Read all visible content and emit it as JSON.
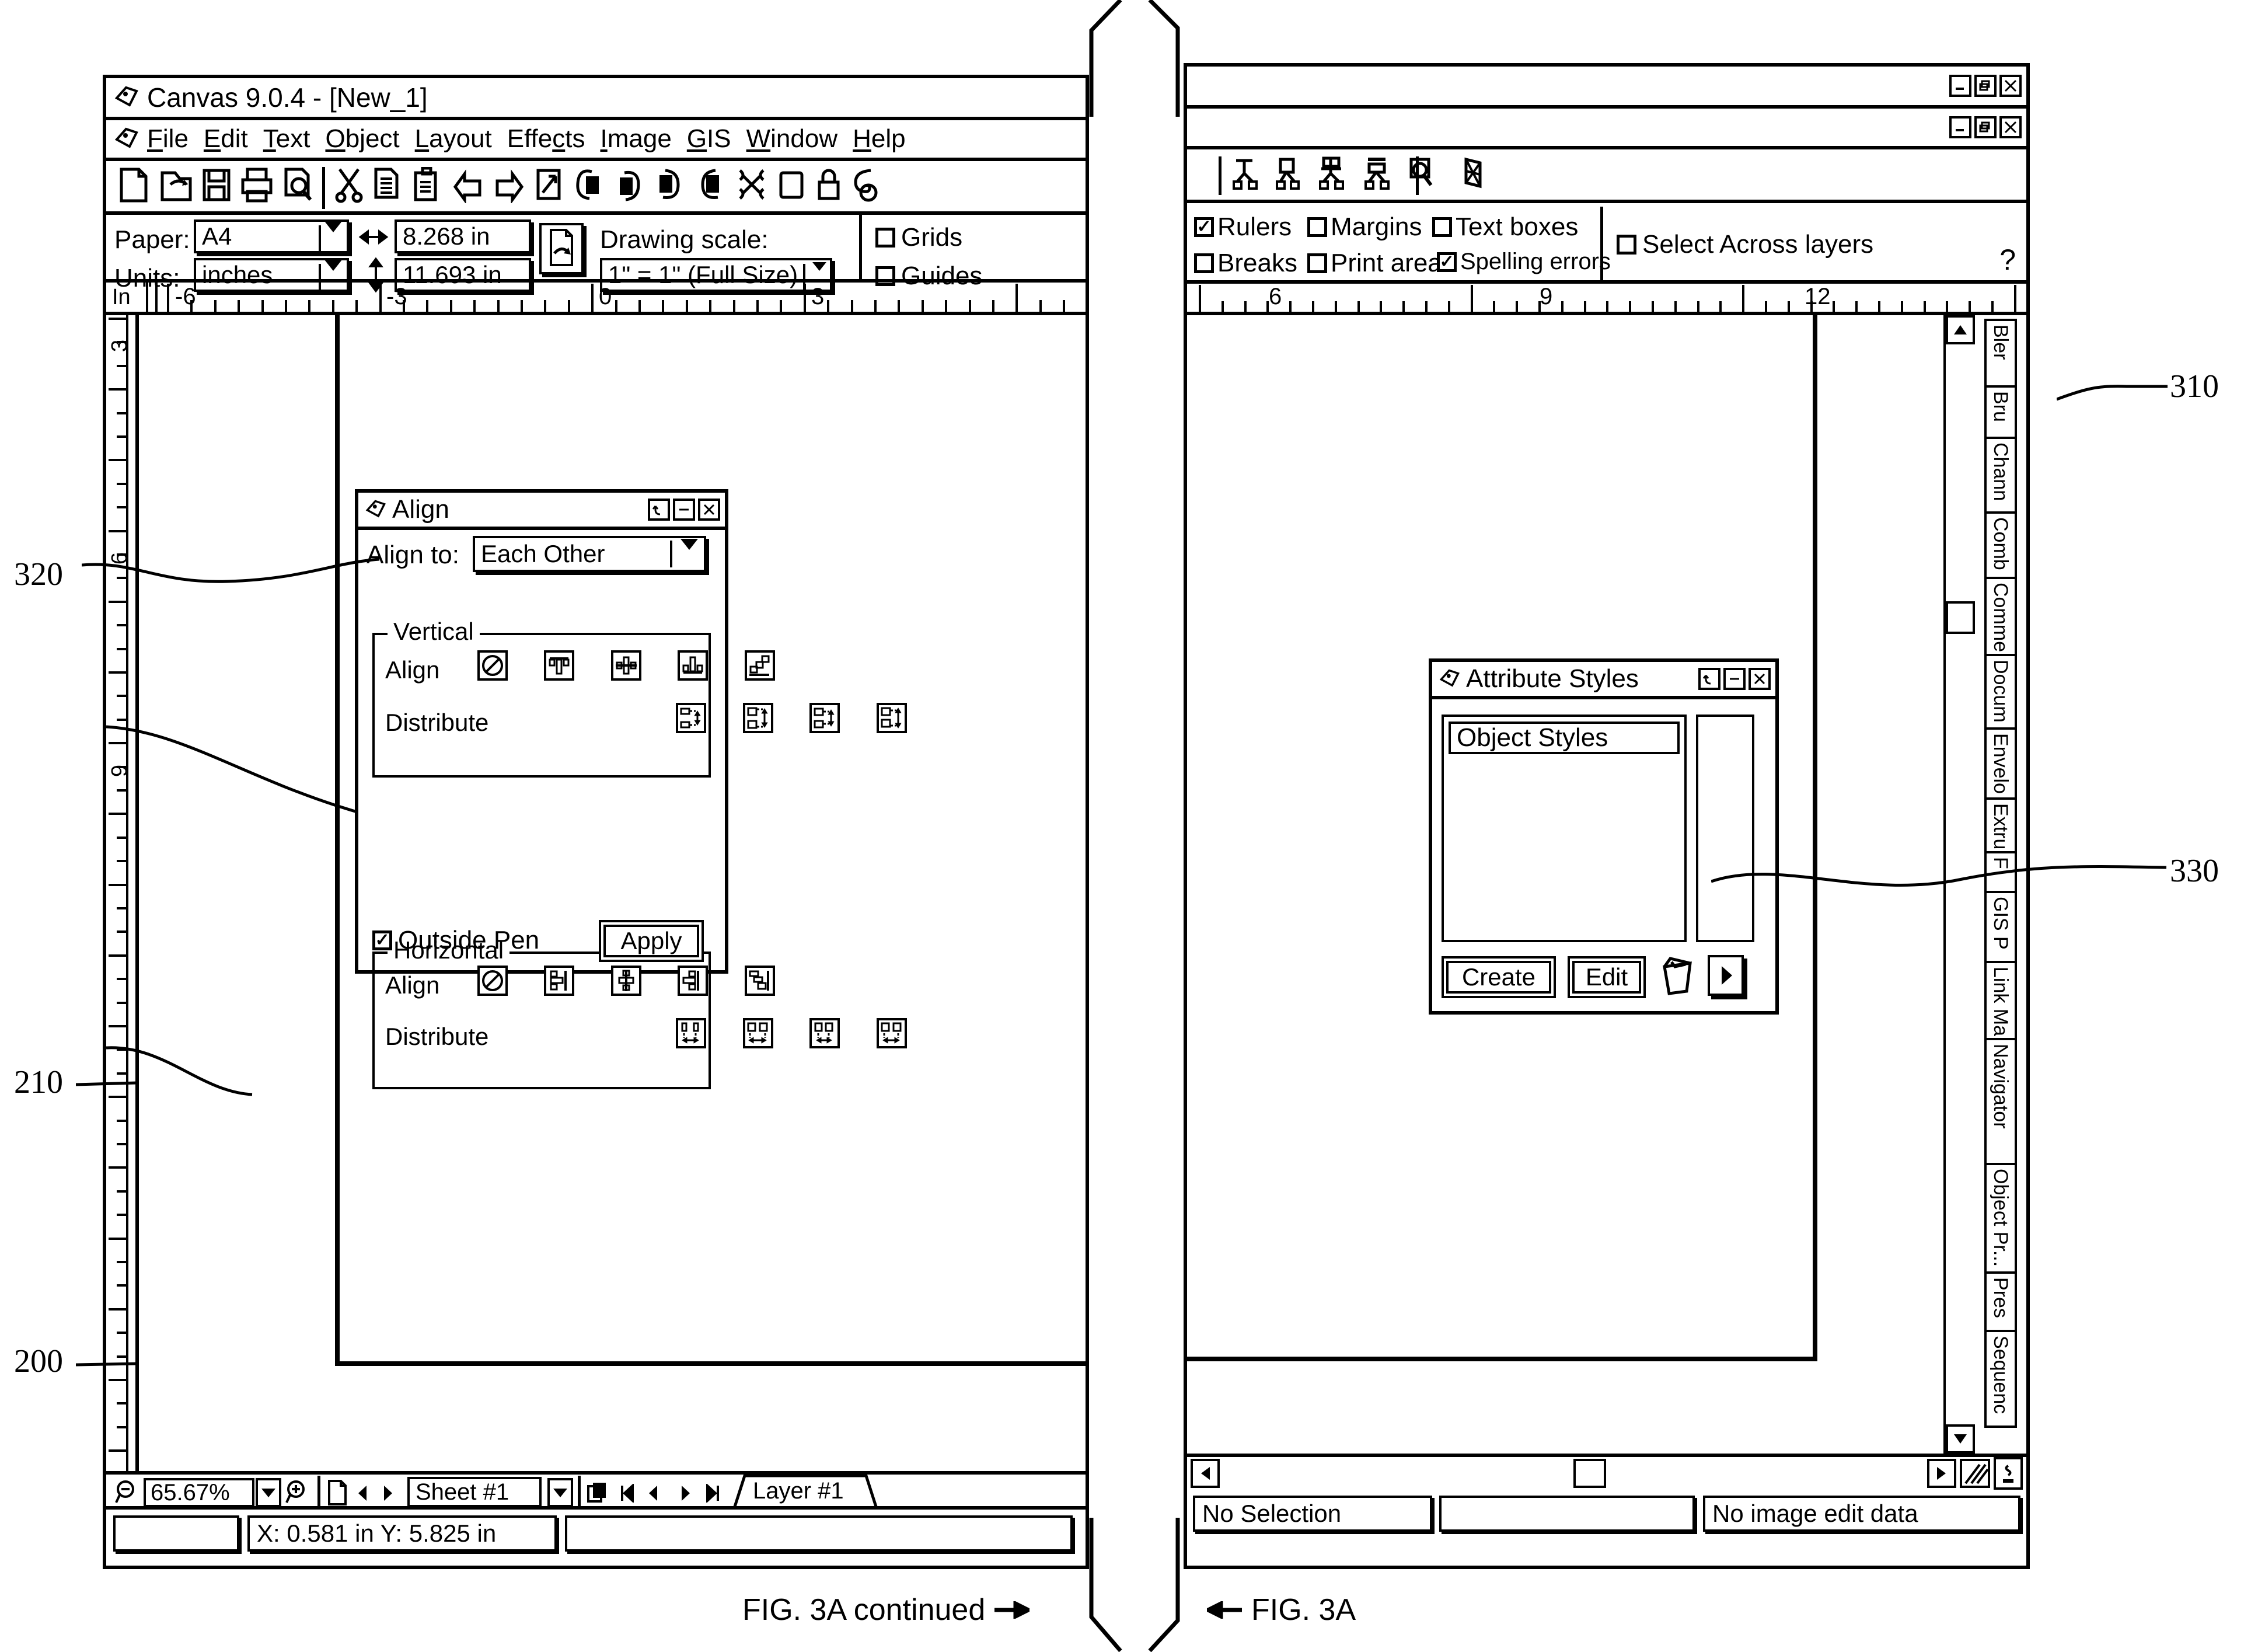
{
  "figure": {
    "left_caption": "FIG. 3A continued",
    "right_caption": "FIG. 3A",
    "ref_320": "320",
    "ref_210": "210",
    "ref_200": "200",
    "ref_310": "310",
    "ref_330": "330"
  },
  "left_window": {
    "title": "Canvas 9.0.4 - [New_1]",
    "menu": [
      {
        "pre": "",
        "u": "F",
        "post": "ile"
      },
      {
        "pre": "",
        "u": "E",
        "post": "dit"
      },
      {
        "pre": "",
        "u": "T",
        "post": "ext"
      },
      {
        "pre": "",
        "u": "O",
        "post": "bject"
      },
      {
        "pre": "",
        "u": "L",
        "post": "ayout"
      },
      {
        "pre": "Effe",
        "u": "c",
        "post": "ts"
      },
      {
        "pre": "",
        "u": "I",
        "post": "mage"
      },
      {
        "pre": "",
        "u": "G",
        "post": "IS"
      },
      {
        "pre": "",
        "u": "W",
        "post": "indow"
      },
      {
        "pre": "",
        "u": "H",
        "post": "elp"
      }
    ],
    "toolbar_icons": [
      "new-document-icon",
      "open-folder-icon",
      "save-disk-icon",
      "print-icon",
      "print-preview-icon",
      "cut-scissors-icon",
      "copy-icon",
      "paste-icon",
      "undo-icon",
      "redo-icon",
      "link-icon",
      "group-icon",
      "ungroup-icon",
      "lock-object-icon",
      "unlock-object-icon",
      "transform-icon",
      "rectangle-icon",
      "lock-icon",
      "lasso-icon"
    ],
    "paper": {
      "paper_label": "Paper:",
      "paper_value": "A4",
      "units_label": "Units:",
      "units_value": "inches",
      "width_value": "8.268 in",
      "height_value": "11.693 in",
      "orientation_icon": "page-orientation-icon",
      "scale_label": "Drawing scale:",
      "scale_value": "1\" = 1\" (Full Size)",
      "grids_label": "Grids",
      "grids_checked": false,
      "guides_label": "Guides",
      "guides_checked": false
    },
    "ruler": {
      "unit_label": "In",
      "ticks": [
        "-6",
        "-3",
        "0",
        "3"
      ],
      "v_ticks": [
        "3",
        "6",
        "9"
      ]
    },
    "zoombar": {
      "zoom_out_icon": "zoom-out-icon",
      "zoom_value": "65.67%",
      "zoom_in_icon": "zoom-in-icon",
      "sheet_icon": "sheet-icon",
      "sheet_value": "Sheet #1",
      "layer_icon": "layers-icon",
      "layer_value": "Layer #1"
    },
    "statusbar": {
      "left_value": "",
      "coords_value": "X: 0.581 in  Y: 5.825 in",
      "right_value": ""
    }
  },
  "align_dialog": {
    "title": "Align",
    "align_to_label": "Align to:",
    "align_to_value": "Each Other",
    "vertical_label": "Vertical",
    "horizontal_label": "Horizontal",
    "align_label": "Align",
    "distribute_label": "Distribute",
    "vertical_align_icons": [
      "align-none-icon",
      "align-top-icon",
      "align-vcenter-icon",
      "align-bottom-icon",
      "align-stagger-v-icon"
    ],
    "vertical_distribute_icons": [
      "distribute-v-1-icon",
      "distribute-v-2-icon",
      "distribute-v-3-icon",
      "distribute-v-4-icon"
    ],
    "horizontal_align_icons": [
      "align-none-icon",
      "align-left-icon",
      "align-hcenter-icon",
      "align-right-icon",
      "align-stagger-h-icon"
    ],
    "horizontal_distribute_icons": [
      "distribute-h-1-icon",
      "distribute-h-2-icon",
      "distribute-h-3-icon",
      "distribute-h-4-icon"
    ],
    "outside_pen_label": "Outside Pen",
    "outside_pen_checked": true,
    "apply_label": "Apply"
  },
  "right_window": {
    "toolbar_icons": [
      "gis-tool-1-icon",
      "gis-tool-2-icon",
      "gis-tool-3-icon",
      "gis-tool-4-icon",
      "gis-tool-5-icon",
      "cube-icon"
    ],
    "options": {
      "rulers_label": "Rulers",
      "rulers_checked": true,
      "margins_label": "Margins",
      "margins_checked": false,
      "textboxes_label": "Text boxes",
      "textboxes_checked": false,
      "breaks_label": "Breaks",
      "breaks_checked": false,
      "printarea_label": "Print area",
      "printarea_checked": false,
      "spelling_label": "Spelling errors",
      "spelling_checked": true,
      "select_across_label": "Select Across layers",
      "select_across_checked": false,
      "help_label": "?"
    },
    "ruler": {
      "ticks": [
        "6",
        "9",
        "12"
      ]
    },
    "palette_tabs": [
      "Bler",
      "Bru",
      "Chann",
      "Comb",
      "Comme",
      "Docum",
      "Envelo",
      "Extru",
      "F",
      "GIS P",
      "Link Ma",
      "Navigator",
      "Object Pr...",
      "Pres",
      "Sequenc"
    ],
    "statusbar": {
      "left_value": "No Selection",
      "middle_value": "",
      "right_value": "No image edit data"
    }
  },
  "attribute_dialog": {
    "title": "Attribute Styles",
    "list_header": "Object Styles",
    "create_label": "Create",
    "edit_label": "Edit",
    "delete_icon": "trash-icon",
    "next_icon": "arrow-right-icon"
  }
}
